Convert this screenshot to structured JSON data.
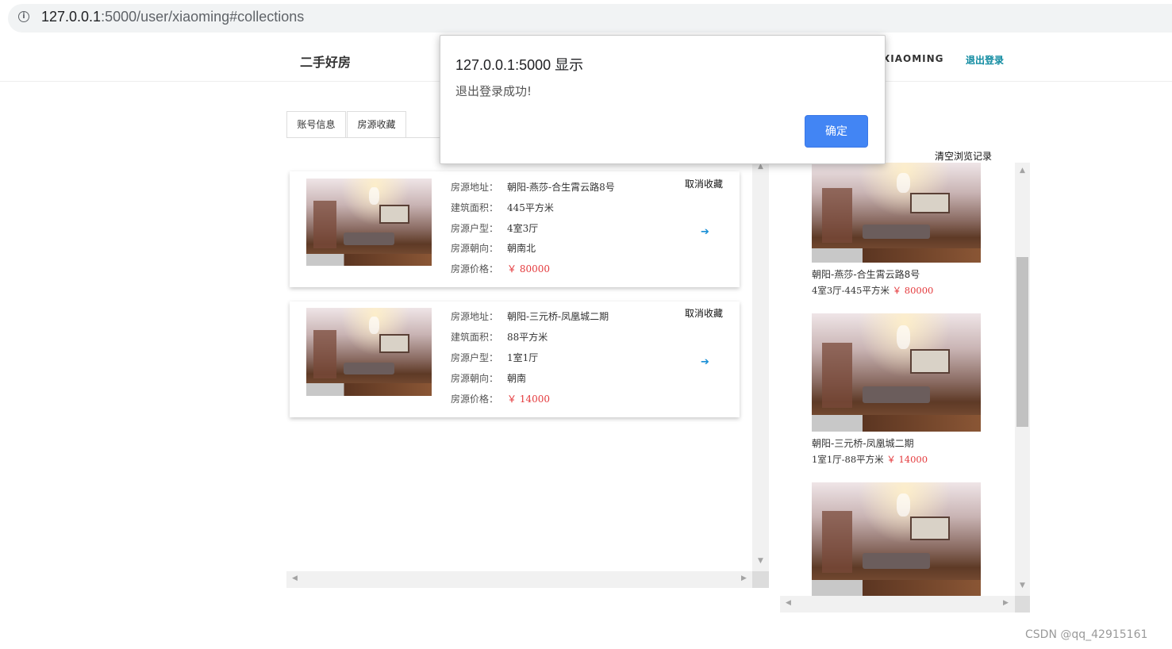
{
  "browser": {
    "url_host": "127.0.0.1",
    "url_rest": ":5000/user/xiaoming#collections"
  },
  "navbar": {
    "brand": "二手好房",
    "username": "XIAOMING",
    "logout": "退出登录"
  },
  "tabs": [
    {
      "label": "账号信息"
    },
    {
      "label": "房源收藏"
    }
  ],
  "field_labels": {
    "address": "房源地址：",
    "area": "建筑面积：",
    "layout": "房源户型：",
    "orientation": "房源朝向：",
    "price": "房源价格："
  },
  "collections": [
    {
      "address": "朝阳-燕莎-合生霄云路8号",
      "area": "445平方米",
      "layout": "4室3厅",
      "orientation": "朝南北",
      "price": "￥ 80000",
      "cancel": "取消收藏",
      "go": "➔"
    },
    {
      "address": "朝阳-三元桥-凤凰城二期",
      "area": "88平方米",
      "layout": "1室1厅",
      "orientation": "朝南",
      "price": "￥ 14000",
      "cancel": "取消收藏",
      "go": "➔"
    }
  ],
  "history": {
    "clear": "清空浏览记录",
    "items": [
      {
        "title": "朝阳-燕莎-合生霄云路8号",
        "desc": "4室3厅-445平方米",
        "price": "￥ 80000"
      },
      {
        "title": "朝阳-三元桥-凤凰城二期",
        "desc": "1室1厅-88平方米",
        "price": "￥ 14000"
      }
    ]
  },
  "dialog": {
    "title": "127.0.0.1:5000 显示",
    "message": "退出登录成功!",
    "ok": "确定"
  },
  "watermark": "CSDN @qq_42915161",
  "colors": {
    "accent": "#4285f4",
    "price": "#e4393c",
    "logout": "#0e8aa0"
  },
  "scroll_arrows": {
    "up": "▲",
    "down": "▼",
    "left": "◀",
    "right": "▶"
  }
}
